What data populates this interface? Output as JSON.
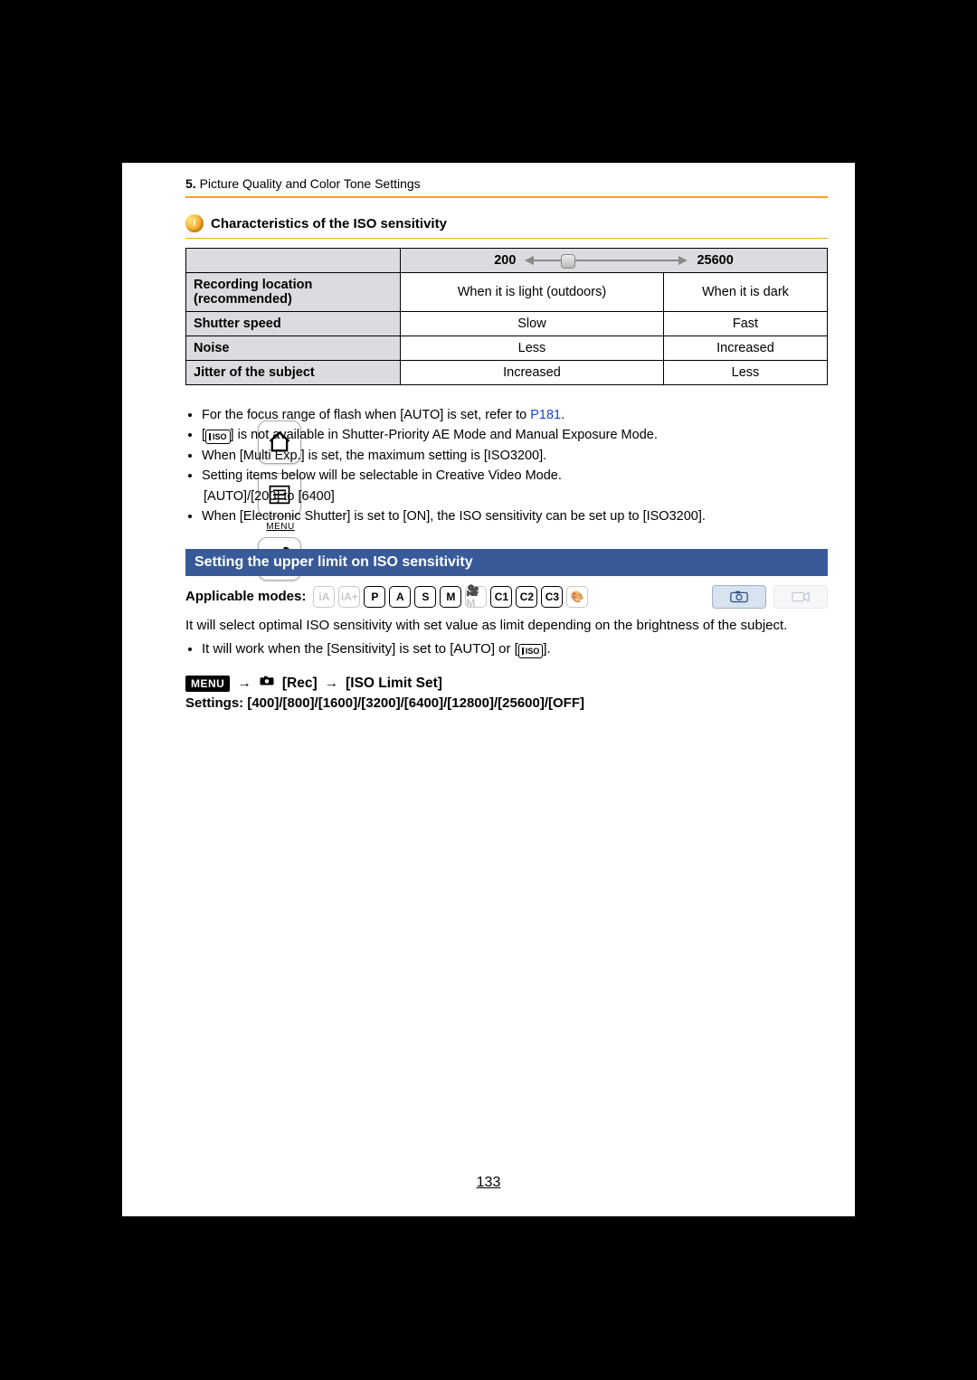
{
  "breadcrumb": {
    "num": "5.",
    "title": "Picture Quality and Color Tone Settings"
  },
  "sidebar_menu_label": "MENU",
  "hint": {
    "title": "Characteristics of the ISO sensitivity"
  },
  "iso_table": {
    "range_low": "200",
    "range_high": "25600",
    "rows": [
      {
        "label": "Recording location (recommended)",
        "low": "When it is light (outdoors)",
        "high": "When it is dark"
      },
      {
        "label": "Shutter speed",
        "low": "Slow",
        "high": "Fast"
      },
      {
        "label": "Noise",
        "low": "Less",
        "high": "Increased"
      },
      {
        "label": "Jitter of the subject",
        "low": "Increased",
        "high": "Less"
      }
    ]
  },
  "notes": {
    "n1a": "For the focus range of flash when [AUTO] is set, refer to ",
    "n1_xref": "P181",
    "n1b": ".",
    "n2a": "[",
    "n2_icon": "ISO",
    "n2b": "] is not available in Shutter-Priority AE Mode and Manual Exposure Mode.",
    "n3": "When [Multi Exp.] is set, the maximum setting is [ISO3200].",
    "n4": "Setting items below will be selectable in Creative Video Mode.",
    "n4_sub": "[AUTO]/[200] to [6400]",
    "n5": "When [Electronic Shutter] is set to [ON], the ISO sensitivity can be set up to [ISO3200]."
  },
  "section_title": "Setting the upper limit on ISO sensitivity",
  "modes": {
    "label": "Applicable modes:",
    "items": [
      {
        "t": "iA",
        "enabled": false
      },
      {
        "t": "iA+",
        "enabled": false
      },
      {
        "t": "P",
        "enabled": true
      },
      {
        "t": "A",
        "enabled": true
      },
      {
        "t": "S",
        "enabled": true
      },
      {
        "t": "M",
        "enabled": true
      },
      {
        "t": "🎥M",
        "enabled": false
      },
      {
        "t": "C1",
        "enabled": true
      },
      {
        "t": "C2",
        "enabled": true
      },
      {
        "t": "C3",
        "enabled": true
      },
      {
        "t": "🎨",
        "enabled": false
      }
    ]
  },
  "section_para": "It will select optimal ISO sensitivity with set value as limit depending on the brightness of the subject.",
  "section_bullet_a": "It will work when the [Sensitivity] is set to [AUTO] or [",
  "section_bullet_icon": "ISO",
  "section_bullet_b": "].",
  "menu_path": {
    "menu_label": "MENU",
    "rec": "[Rec]",
    "target": "[ISO Limit Set]"
  },
  "settings_line": "Settings: [400]/[800]/[1600]/[3200]/[6400]/[12800]/[25600]/[OFF]",
  "page_number": "133"
}
